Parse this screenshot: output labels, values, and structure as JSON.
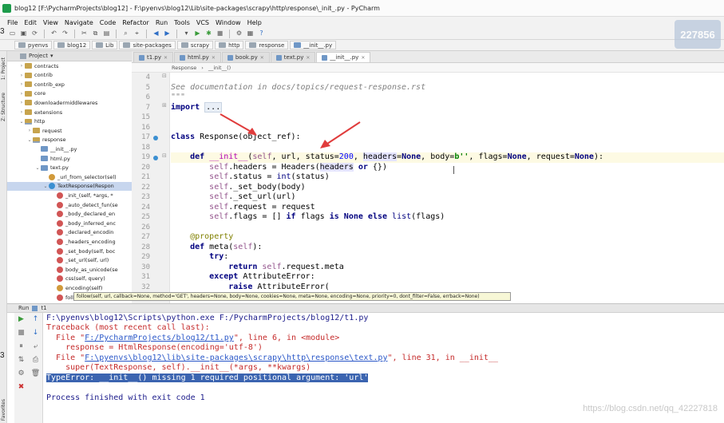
{
  "window": {
    "title": "blog12 [F:\\PycharmProjects\\blog12] - F:\\pyenvs\\blog12\\Lib\\site-packages\\scrapy\\http\\response\\_init_.py - PyCharm"
  },
  "menu": [
    "File",
    "Edit",
    "View",
    "Navigate",
    "Code",
    "Refactor",
    "Run",
    "Tools",
    "VCS",
    "Window",
    "Help"
  ],
  "breadcrumbs": [
    "pyenvs",
    "blog12",
    "Lib",
    "site-packages",
    "scrapy",
    "http",
    "response",
    "__init__.py"
  ],
  "project": {
    "header": "Project",
    "tree": [
      {
        "indent": 1,
        "arrow": "›",
        "icon": "fold",
        "label": "contracts"
      },
      {
        "indent": 1,
        "arrow": "›",
        "icon": "fold",
        "label": "contrib"
      },
      {
        "indent": 1,
        "arrow": "›",
        "icon": "fold",
        "label": "contrib_exp"
      },
      {
        "indent": 1,
        "arrow": "›",
        "icon": "fold",
        "label": "core"
      },
      {
        "indent": 1,
        "arrow": "›",
        "icon": "fold",
        "label": "downloadermiddlewares"
      },
      {
        "indent": 1,
        "arrow": "›",
        "icon": "fold",
        "label": "extensions"
      },
      {
        "indent": 1,
        "arrow": "⌄",
        "icon": "pkg",
        "label": "http"
      },
      {
        "indent": 2,
        "arrow": "›",
        "icon": "fold",
        "label": "request"
      },
      {
        "indent": 2,
        "arrow": "⌄",
        "icon": "pkg",
        "label": "response"
      },
      {
        "indent": 3,
        "arrow": "",
        "icon": "pyf",
        "label": "__init__.py"
      },
      {
        "indent": 3,
        "arrow": "",
        "icon": "pyf",
        "label": "html.py"
      },
      {
        "indent": 3,
        "arrow": "⌄",
        "icon": "pyf",
        "label": "text.py"
      },
      {
        "indent": 4,
        "arrow": "",
        "icon": "fld",
        "label": "_url_from_selector(sel)"
      },
      {
        "indent": 4,
        "arrow": "⌄",
        "icon": "cls",
        "label": "TextResponse(Respon",
        "selected": true
      },
      {
        "indent": 5,
        "arrow": "",
        "icon": "mth",
        "label": "_init_(self, *args, *"
      },
      {
        "indent": 5,
        "arrow": "",
        "icon": "mth",
        "label": "_auto_detect_fun(se"
      },
      {
        "indent": 5,
        "arrow": "",
        "icon": "mth",
        "label": "_body_declared_en"
      },
      {
        "indent": 5,
        "arrow": "",
        "icon": "mth",
        "label": "_body_inferred_enc"
      },
      {
        "indent": 5,
        "arrow": "",
        "icon": "mth",
        "label": "_declared_encodin"
      },
      {
        "indent": 5,
        "arrow": "",
        "icon": "mth",
        "label": "_headers_encoding"
      },
      {
        "indent": 5,
        "arrow": "",
        "icon": "mth",
        "label": "_set_body(self, boc"
      },
      {
        "indent": 5,
        "arrow": "",
        "icon": "mth",
        "label": "_set_url(self, url)"
      },
      {
        "indent": 5,
        "arrow": "",
        "icon": "mth",
        "label": "body_as_unicode(se"
      },
      {
        "indent": 5,
        "arrow": "",
        "icon": "mth",
        "label": "css(self, query)"
      },
      {
        "indent": 5,
        "arrow": "",
        "icon": "fld",
        "label": "encoding(self)"
      },
      {
        "indent": 5,
        "arrow": "",
        "icon": "mth",
        "label": "follow(self, url, call"
      }
    ]
  },
  "editor": {
    "tabs": [
      {
        "label": "t1.py",
        "active": false
      },
      {
        "label": "html.py",
        "active": false
      },
      {
        "label": "book.py",
        "active": false
      },
      {
        "label": "text.py",
        "active": false
      },
      {
        "label": "__init__.py",
        "active": true
      }
    ],
    "crumb_class": "Response",
    "crumb_method": "__init__()",
    "line_numbers": [
      "4",
      "5",
      "6",
      "7",
      "15",
      "16",
      "17",
      "18",
      "19",
      "20",
      "21",
      "22",
      "23",
      "24",
      "25",
      "26",
      "27",
      "28",
      "29",
      "30",
      "31",
      "32",
      "33"
    ]
  },
  "tooltip": "follow(self, url, callback=None, method='GET', headers=None, body=None, cookies=None, meta=None, encoding=None, priority=0, dont_filter=False, errback=None)",
  "run": {
    "header": "Run",
    "config": "t1",
    "lines": [
      "F:\\pyenvs\\blog12\\Scripts\\python.exe F:/PycharmProjects/blog12/t1.py",
      "Traceback (most recent call last):",
      "  File \"",
      "F:/PycharmProjects/blog12/t1.py",
      "\", line 6, in <module>",
      "    response = HtmlResponse(encoding='utf-8')",
      "F:\\pyenvs\\blog12\\lib\\site-packages\\scrapy\\http\\response\\text.py",
      "\", line 31, in __init__",
      "    super(TextResponse, self).__init__(*args, **kwargs)",
      "TypeError: __init__() missing 1 required positional argument: 'url'",
      "Process finished with exit code 1"
    ]
  },
  "overlay": {
    "badge": "227856",
    "watermark": "https://blog.csdn.net/qq_42227818",
    "side_numbers": [
      "3",
      "3"
    ]
  },
  "colors": {
    "keyword": "#000080",
    "string": "#008000",
    "self": "#94558d",
    "error": "#c52b2b",
    "link": "#2a57c8",
    "selection": "#3b64b0",
    "arrows": "#e03c3c"
  }
}
